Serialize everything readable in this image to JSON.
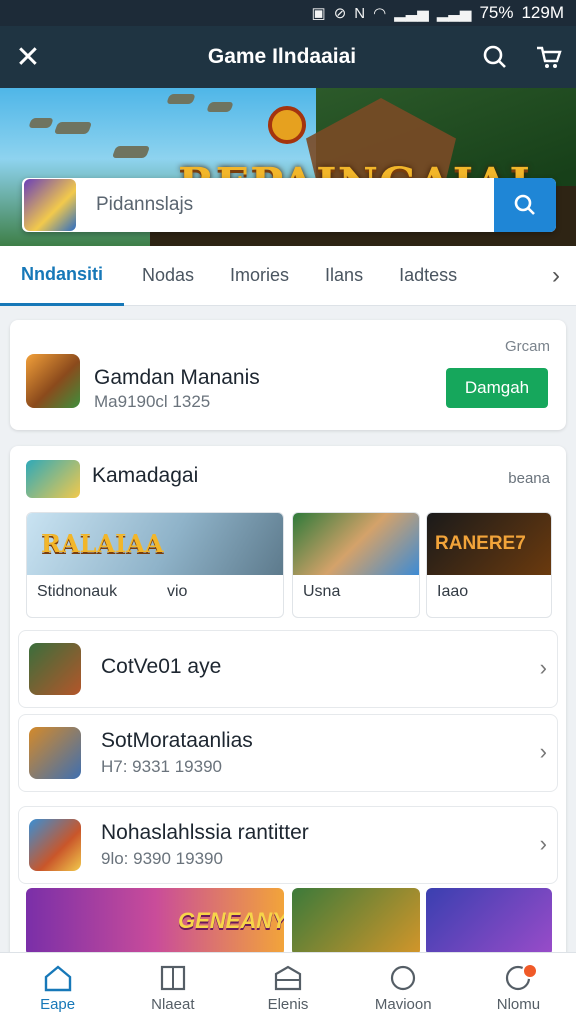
{
  "status_bar": {
    "battery": "75%",
    "time": "129M"
  },
  "app_bar": {
    "title": "Game Ilndaaiai"
  },
  "banner": {
    "logo_text": "REPAINGAIAL"
  },
  "search": {
    "placeholder": "Pidannslajs"
  },
  "tabs": [
    {
      "label": "Nndansiti",
      "active": true
    },
    {
      "label": "Nodas"
    },
    {
      "label": "Imories"
    },
    {
      "label": "Ilans"
    },
    {
      "label": "Iadtess"
    }
  ],
  "featured": {
    "tag": "Grcam",
    "name": "Gamdan Mananis",
    "meta": "Ma9190cl 1325",
    "button": "Damgah"
  },
  "section": {
    "title": "Kamadagai",
    "link": "beana",
    "thumbs": [
      {
        "banner_text": "RALAIAA",
        "caption": "Stidnonauk",
        "caption2": "vio"
      },
      {
        "caption": "Usna"
      },
      {
        "banner_text": "RANERE7",
        "caption": "Iaao"
      }
    ],
    "rows": [
      {
        "title": "CotVe01 aye"
      },
      {
        "title": "SotMorataanlias",
        "sub": "H7: 9331 19390"
      },
      {
        "title": "Nohaslahlssia rantitter",
        "sub": "9lo: 9390 19390"
      }
    ],
    "strip_text": "GENEANY"
  },
  "bottom_nav": [
    {
      "label": "Eape",
      "active": true
    },
    {
      "label": "Nlaeat"
    },
    {
      "label": "Elenis"
    },
    {
      "label": "Mavioon"
    },
    {
      "label": "Nlomu"
    }
  ]
}
